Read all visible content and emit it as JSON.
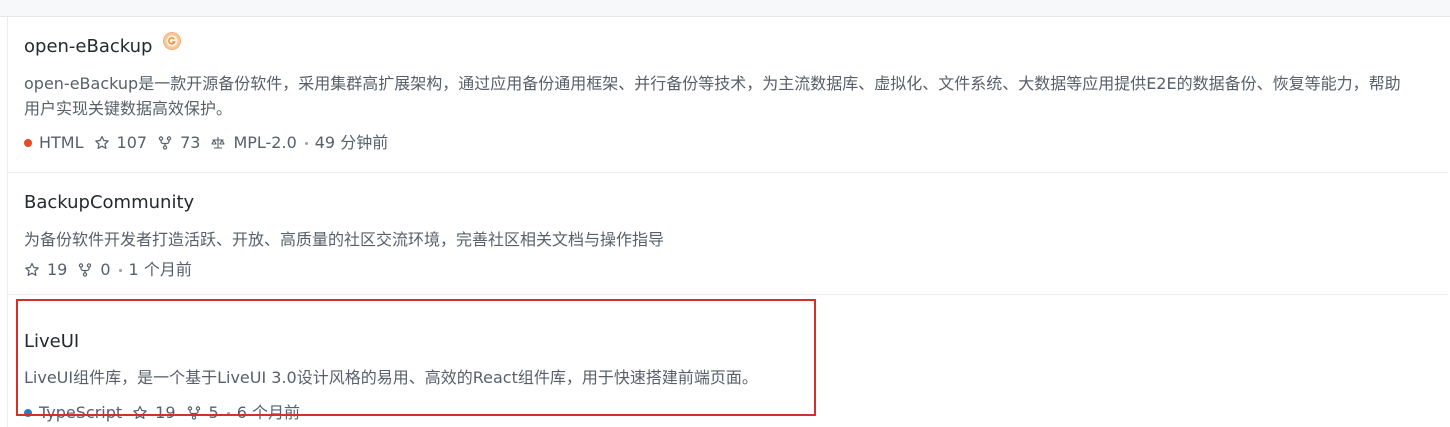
{
  "repos": [
    {
      "name": "open-eBackup",
      "badge_icon": "gitee-recommend-badge-icon",
      "description": "open-eBackup是一款开源备份软件，采用集群高扩展架构，通过应用备份通用框架、并行备份等技术，为主流数据库、虚拟化、文件系统、大数据等应用提供E2E的数据备份、恢复等能力，帮助用户实现关键数据高效保护。",
      "language": "HTML",
      "language_color": "#e34c26",
      "stars": "107",
      "forks": "73",
      "license": "MPL-2.0",
      "updated": "49 分钟前"
    },
    {
      "name": "BackupCommunity",
      "description": "为备份软件开发者打造活跃、开放、高质量的社区交流环境，完善社区相关文档与操作指导",
      "stars": "19",
      "forks": "0",
      "updated": "1 个月前"
    },
    {
      "name": "LiveUI",
      "description": "LiveUI组件库，是一个基于LiveUI 3.0设计风格的易用、高效的React组件库，用于快速搭建前端页面。",
      "language": "TypeScript",
      "language_color": "#3178c6",
      "stars": "19",
      "forks": "5",
      "updated": "6 个月前"
    }
  ],
  "highlight_color": "#d32f2f"
}
